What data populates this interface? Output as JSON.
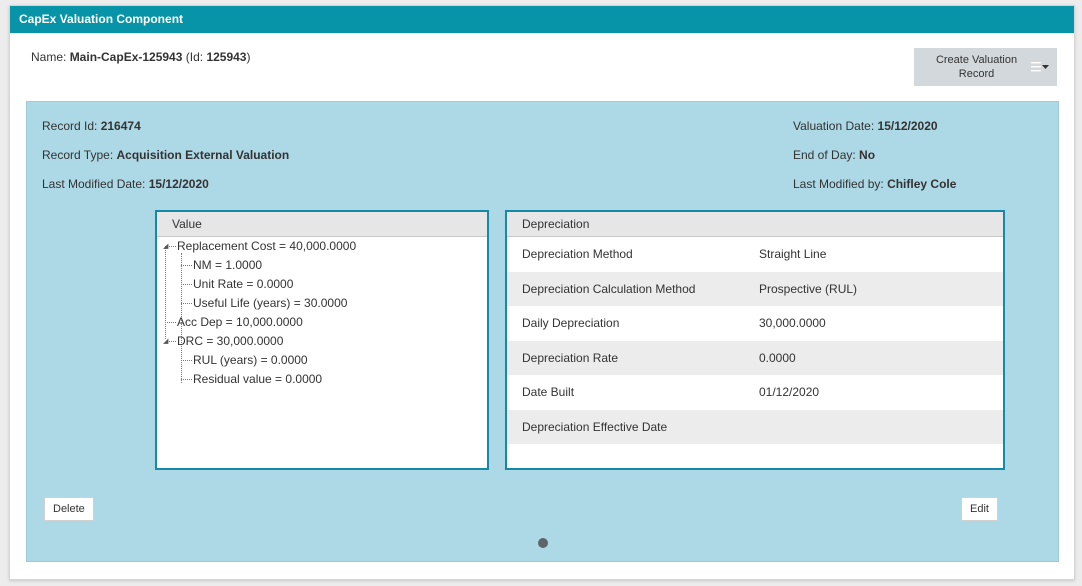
{
  "header": {
    "title": "CapEx Valuation Component"
  },
  "name_line": {
    "label": "Name:",
    "value": "Main-CapEx-125943",
    "id_prefix": "(Id:",
    "id_value": "125943",
    "id_suffix": ")"
  },
  "toolbar": {
    "create_label": "Create Valuation Record",
    "menu_icon": "hamburger-caret-icon"
  },
  "record": {
    "record_id_label": "Record Id:",
    "record_id": "216474",
    "record_type_label": "Record Type:",
    "record_type": "Acquisition External Valuation",
    "last_modified_date_label": "Last Modified Date:",
    "last_modified_date": "15/12/2020",
    "valuation_date_label": "Valuation Date:",
    "valuation_date": "15/12/2020",
    "end_of_day_label": "End of Day:",
    "end_of_day": "No",
    "last_modified_by_label": "Last Modified by:",
    "last_modified_by": "Chifley Cole"
  },
  "value_tree": {
    "header": "Value",
    "nodes": [
      "Replacement Cost = 40,000.0000",
      "NM = 1.0000",
      "Unit Rate = 0.0000",
      "Useful Life (years) = 30.0000",
      "Acc Dep = 10,000.0000",
      "DRC = 30,000.0000",
      "RUL (years) = 0.0000",
      "Residual value = 0.0000"
    ]
  },
  "depreciation": {
    "header": "Depreciation",
    "rows": [
      {
        "key": "Depreciation Method",
        "value": "Straight Line"
      },
      {
        "key": "Depreciation Calculation Method",
        "value": "Prospective (RUL)"
      },
      {
        "key": "Daily Depreciation",
        "value": "30,000.0000"
      },
      {
        "key": "Depreciation Rate",
        "value": "0.0000"
      },
      {
        "key": "Date Built",
        "value": "01/12/2020"
      },
      {
        "key": "Depreciation Effective Date",
        "value": ""
      }
    ]
  },
  "actions": {
    "delete_label": "Delete",
    "edit_label": "Edit"
  }
}
